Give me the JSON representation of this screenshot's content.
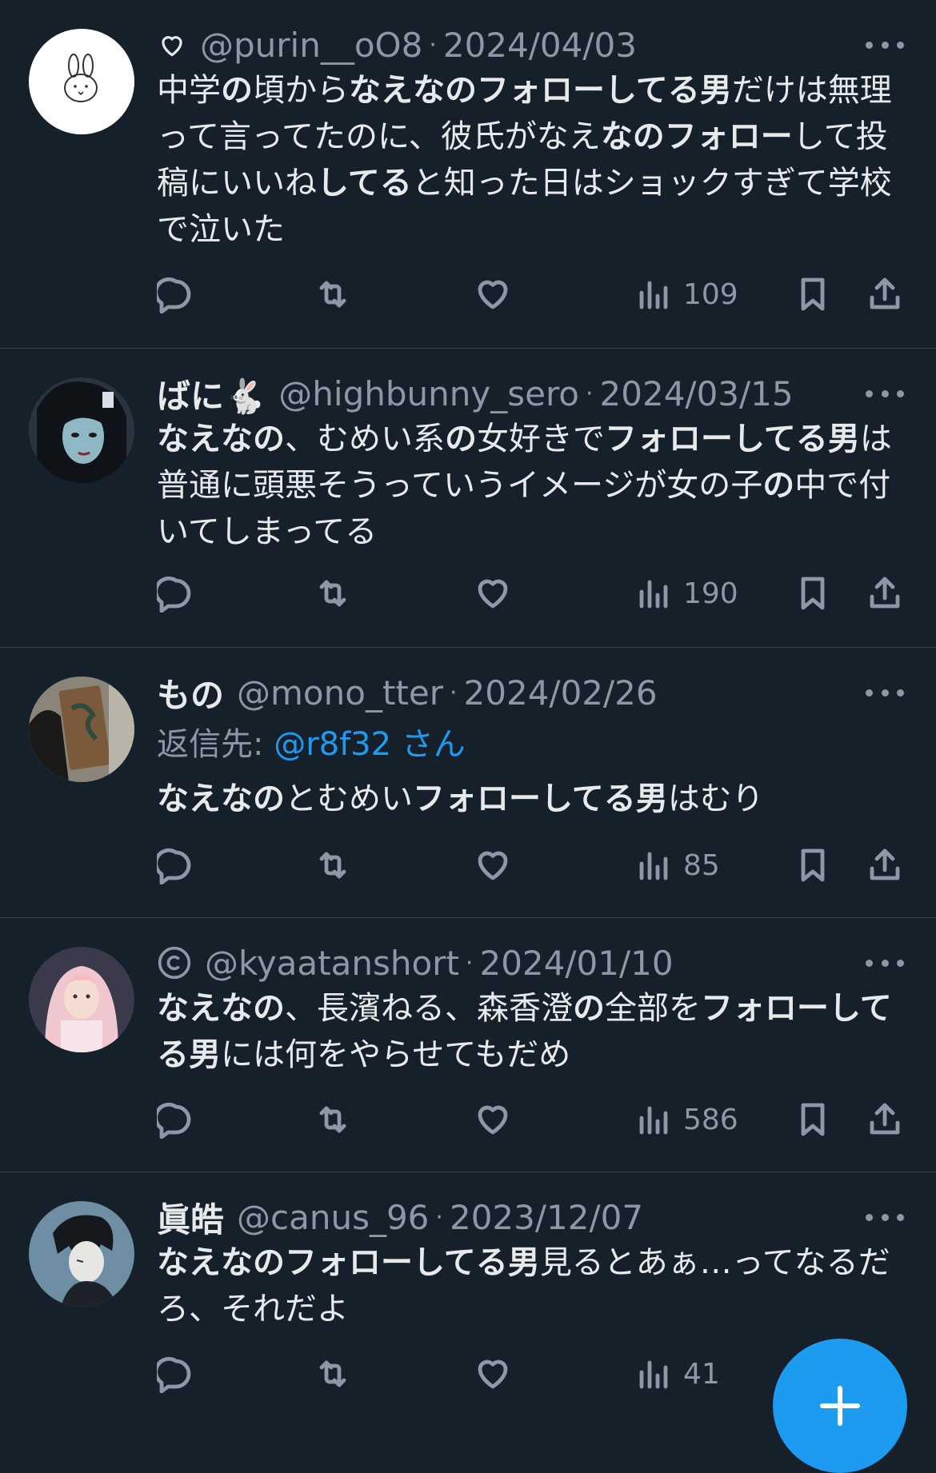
{
  "tweets": [
    {
      "name": "",
      "handle": "@purin__oO8",
      "date": "2024/04/03",
      "pre_icon": "heart-outline-icon",
      "avatar": "miffy-avatar",
      "text_parts": [
        {
          "t": "中学",
          "b": false
        },
        {
          "t": "の",
          "b": true
        },
        {
          "t": "頃から",
          "b": false
        },
        {
          "t": "なえなのフォローしてる男",
          "b": true
        },
        {
          "t": "だけは無理って言ってたのに、彼氏がなえ",
          "b": false
        },
        {
          "t": "なのフォロー",
          "b": true
        },
        {
          "t": "して投稿にいいね",
          "b": false
        },
        {
          "t": "してる",
          "b": true
        },
        {
          "t": "と知った日はショックすぎて学校で泣いた",
          "b": false
        }
      ],
      "views": "109",
      "show_bookmark": true,
      "show_share": true
    },
    {
      "name": "ばに🐇",
      "handle": "@highbunny_sero",
      "date": "2024/03/15",
      "avatar": "dark-hair-character-avatar",
      "text_parts": [
        {
          "t": "なえなの",
          "b": true
        },
        {
          "t": "、むめい系",
          "b": false
        },
        {
          "t": "の",
          "b": true
        },
        {
          "t": "女好きで",
          "b": false
        },
        {
          "t": "フォローしてる男",
          "b": true
        },
        {
          "t": "は普通に頭悪そうっていうイメージが女の子",
          "b": false
        },
        {
          "t": "の",
          "b": true
        },
        {
          "t": "中で付いてしまってる",
          "b": false
        }
      ],
      "views": "190",
      "show_bookmark": true,
      "show_share": true
    },
    {
      "name": "もの",
      "handle": "@mono_tter",
      "date": "2024/02/26",
      "avatar": "photo-avatar",
      "reply_label": "返信先: ",
      "reply_mention": "@r8f32 さん",
      "text_parts": [
        {
          "t": "なえなの",
          "b": true
        },
        {
          "t": "とむめい",
          "b": false
        },
        {
          "t": "フォローしてる男",
          "b": true
        },
        {
          "t": "はむり",
          "b": false
        }
      ],
      "views": "85",
      "show_bookmark": true,
      "show_share": true
    },
    {
      "name": "",
      "handle": "@kyaatanshort",
      "date": "2024/01/10",
      "pre_icon": "copyright-icon",
      "avatar": "pink-idol-avatar",
      "text_parts": [
        {
          "t": "なえなの",
          "b": true
        },
        {
          "t": "、長濱ねる、森香澄",
          "b": false
        },
        {
          "t": "の",
          "b": true
        },
        {
          "t": "全部を",
          "b": false
        },
        {
          "t": "フォローしてる男",
          "b": true
        },
        {
          "t": "には何をやらせてもだめ",
          "b": false
        }
      ],
      "views": "586",
      "show_bookmark": true,
      "show_share": true
    },
    {
      "name": "眞皓",
      "handle": "@canus_96",
      "date": "2023/12/07",
      "avatar": "anime-boy-avatar",
      "text_parts": [
        {
          "t": "なえなのフォローしてる男",
          "b": true
        },
        {
          "t": "見るとあぁ…ってなるだろ、それだよ",
          "b": false
        }
      ],
      "views": "41",
      "show_bookmark": false,
      "show_share": false
    }
  ],
  "fab": {
    "icon": "plus-icon"
  },
  "colors": {
    "background": "#15202b",
    "accent": "#1d9bf0",
    "muted": "#8b98a5",
    "text": "#e7e9ea"
  }
}
